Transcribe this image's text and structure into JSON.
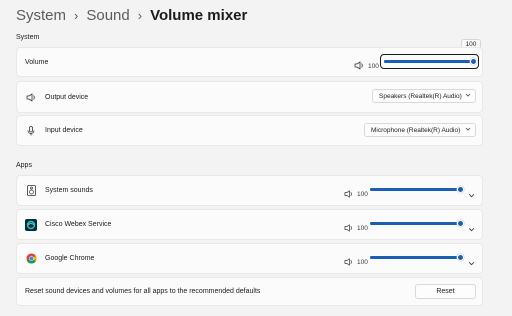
{
  "breadcrumb": {
    "items": [
      "System",
      "Sound"
    ],
    "current": "Volume mixer"
  },
  "system_section": {
    "label": "System",
    "volume": {
      "label": "Volume",
      "value": "100",
      "level": 1.0,
      "tooltip": "100"
    },
    "output_device": {
      "label": "Output device",
      "selected": "Speakers (Realtek(R) Audio)"
    },
    "input_device": {
      "label": "Input device",
      "selected": "Microphone (Realtek(R) Audio)"
    }
  },
  "apps_section": {
    "label": "Apps",
    "apps": [
      {
        "name": "System sounds",
        "value": "100",
        "level": 1.0,
        "icon": "speaker-box-icon"
      },
      {
        "name": "Cisco Webex Service",
        "value": "100",
        "level": 1.0,
        "icon": "webex-icon"
      },
      {
        "name": "Google Chrome",
        "value": "100",
        "level": 1.0,
        "icon": "chrome-icon"
      }
    ]
  },
  "reset": {
    "description": "Reset sound devices and volumes for all apps to the recommended defaults",
    "button_label": "Reset"
  },
  "colors": {
    "accent": "#1a5fb4",
    "background": "#f3f3f3",
    "card": "#fbfbfb"
  }
}
